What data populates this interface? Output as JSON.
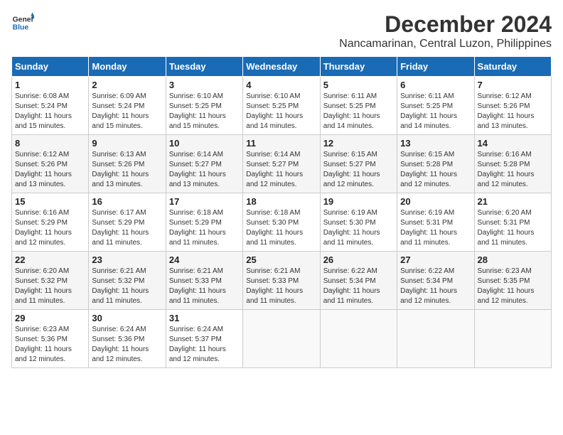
{
  "header": {
    "logo_line1": "General",
    "logo_line2": "Blue",
    "title": "December 2024",
    "subtitle": "Nancamarinan, Central Luzon, Philippines"
  },
  "calendar": {
    "days_of_week": [
      "Sunday",
      "Monday",
      "Tuesday",
      "Wednesday",
      "Thursday",
      "Friday",
      "Saturday"
    ],
    "weeks": [
      [
        {
          "day": "",
          "detail": ""
        },
        {
          "day": "2",
          "detail": "Sunrise: 6:09 AM\nSunset: 5:24 PM\nDaylight: 11 hours\nand 15 minutes."
        },
        {
          "day": "3",
          "detail": "Sunrise: 6:10 AM\nSunset: 5:25 PM\nDaylight: 11 hours\nand 15 minutes."
        },
        {
          "day": "4",
          "detail": "Sunrise: 6:10 AM\nSunset: 5:25 PM\nDaylight: 11 hours\nand 14 minutes."
        },
        {
          "day": "5",
          "detail": "Sunrise: 6:11 AM\nSunset: 5:25 PM\nDaylight: 11 hours\nand 14 minutes."
        },
        {
          "day": "6",
          "detail": "Sunrise: 6:11 AM\nSunset: 5:25 PM\nDaylight: 11 hours\nand 14 minutes."
        },
        {
          "day": "7",
          "detail": "Sunrise: 6:12 AM\nSunset: 5:26 PM\nDaylight: 11 hours\nand 13 minutes."
        }
      ],
      [
        {
          "day": "8",
          "detail": "Sunrise: 6:12 AM\nSunset: 5:26 PM\nDaylight: 11 hours\nand 13 minutes."
        },
        {
          "day": "9",
          "detail": "Sunrise: 6:13 AM\nSunset: 5:26 PM\nDaylight: 11 hours\nand 13 minutes."
        },
        {
          "day": "10",
          "detail": "Sunrise: 6:14 AM\nSunset: 5:27 PM\nDaylight: 11 hours\nand 13 minutes."
        },
        {
          "day": "11",
          "detail": "Sunrise: 6:14 AM\nSunset: 5:27 PM\nDaylight: 11 hours\nand 12 minutes."
        },
        {
          "day": "12",
          "detail": "Sunrise: 6:15 AM\nSunset: 5:27 PM\nDaylight: 11 hours\nand 12 minutes."
        },
        {
          "day": "13",
          "detail": "Sunrise: 6:15 AM\nSunset: 5:28 PM\nDaylight: 11 hours\nand 12 minutes."
        },
        {
          "day": "14",
          "detail": "Sunrise: 6:16 AM\nSunset: 5:28 PM\nDaylight: 11 hours\nand 12 minutes."
        }
      ],
      [
        {
          "day": "15",
          "detail": "Sunrise: 6:16 AM\nSunset: 5:29 PM\nDaylight: 11 hours\nand 12 minutes."
        },
        {
          "day": "16",
          "detail": "Sunrise: 6:17 AM\nSunset: 5:29 PM\nDaylight: 11 hours\nand 11 minutes."
        },
        {
          "day": "17",
          "detail": "Sunrise: 6:18 AM\nSunset: 5:29 PM\nDaylight: 11 hours\nand 11 minutes."
        },
        {
          "day": "18",
          "detail": "Sunrise: 6:18 AM\nSunset: 5:30 PM\nDaylight: 11 hours\nand 11 minutes."
        },
        {
          "day": "19",
          "detail": "Sunrise: 6:19 AM\nSunset: 5:30 PM\nDaylight: 11 hours\nand 11 minutes."
        },
        {
          "day": "20",
          "detail": "Sunrise: 6:19 AM\nSunset: 5:31 PM\nDaylight: 11 hours\nand 11 minutes."
        },
        {
          "day": "21",
          "detail": "Sunrise: 6:20 AM\nSunset: 5:31 PM\nDaylight: 11 hours\nand 11 minutes."
        }
      ],
      [
        {
          "day": "22",
          "detail": "Sunrise: 6:20 AM\nSunset: 5:32 PM\nDaylight: 11 hours\nand 11 minutes."
        },
        {
          "day": "23",
          "detail": "Sunrise: 6:21 AM\nSunset: 5:32 PM\nDaylight: 11 hours\nand 11 minutes."
        },
        {
          "day": "24",
          "detail": "Sunrise: 6:21 AM\nSunset: 5:33 PM\nDaylight: 11 hours\nand 11 minutes."
        },
        {
          "day": "25",
          "detail": "Sunrise: 6:21 AM\nSunset: 5:33 PM\nDaylight: 11 hours\nand 11 minutes."
        },
        {
          "day": "26",
          "detail": "Sunrise: 6:22 AM\nSunset: 5:34 PM\nDaylight: 11 hours\nand 11 minutes."
        },
        {
          "day": "27",
          "detail": "Sunrise: 6:22 AM\nSunset: 5:34 PM\nDaylight: 11 hours\nand 12 minutes."
        },
        {
          "day": "28",
          "detail": "Sunrise: 6:23 AM\nSunset: 5:35 PM\nDaylight: 11 hours\nand 12 minutes."
        }
      ],
      [
        {
          "day": "29",
          "detail": "Sunrise: 6:23 AM\nSunset: 5:36 PM\nDaylight: 11 hours\nand 12 minutes."
        },
        {
          "day": "30",
          "detail": "Sunrise: 6:24 AM\nSunset: 5:36 PM\nDaylight: 11 hours\nand 12 minutes."
        },
        {
          "day": "31",
          "detail": "Sunrise: 6:24 AM\nSunset: 5:37 PM\nDaylight: 11 hours\nand 12 minutes."
        },
        {
          "day": "",
          "detail": ""
        },
        {
          "day": "",
          "detail": ""
        },
        {
          "day": "",
          "detail": ""
        },
        {
          "day": "",
          "detail": ""
        }
      ]
    ],
    "week0_day1": {
      "day": "1",
      "detail": "Sunrise: 6:08 AM\nSunset: 5:24 PM\nDaylight: 11 hours\nand 15 minutes."
    }
  }
}
